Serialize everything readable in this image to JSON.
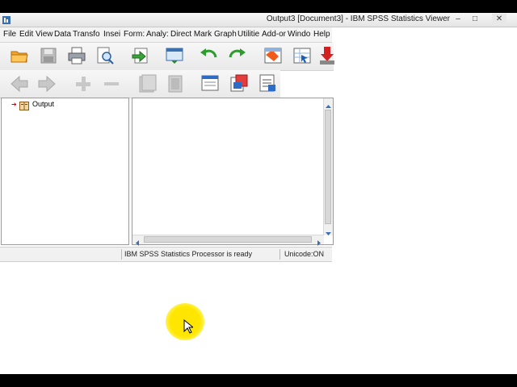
{
  "window": {
    "title": "Output3 [Document3] - IBM SPSS Statistics Viewer",
    "minimize_label": "–",
    "maximize_label": "□",
    "close_label": "✕"
  },
  "menu": [
    {
      "label": "File"
    },
    {
      "label": "Edit"
    },
    {
      "label": "View"
    },
    {
      "label": "Data"
    },
    {
      "label": "Transfo"
    },
    {
      "label": "Insei"
    },
    {
      "label": "Form:"
    },
    {
      "label": "Analy:"
    },
    {
      "label": "Direct Mark"
    },
    {
      "label": "Graph"
    },
    {
      "label": "Utilitie"
    },
    {
      "label": "Add-or"
    },
    {
      "label": "Windo"
    },
    {
      "label": "Help"
    }
  ],
  "toolbar1": [
    "open-icon",
    "save-icon",
    "print-icon",
    "print-preview-icon",
    "export-icon",
    "recall-dialog-icon",
    "undo-icon",
    "redo-icon",
    "goto-data-icon",
    "goto-variable-icon",
    "insert-output-icon"
  ],
  "toolbar2": [
    "promote-icon",
    "demote-icon",
    "expand-icon",
    "collapse-icon",
    "show-icon",
    "hide-icon",
    "insert-heading-icon",
    "insert-title-icon",
    "insert-text-icon"
  ],
  "outline": {
    "root_label": "Output"
  },
  "status": {
    "processor": "IBM SPSS Statistics Processor is ready",
    "unicode": "Unicode:ON"
  },
  "colors": {
    "cursor_highlight": "#ffe600",
    "tree_arrow": "#d00000"
  }
}
